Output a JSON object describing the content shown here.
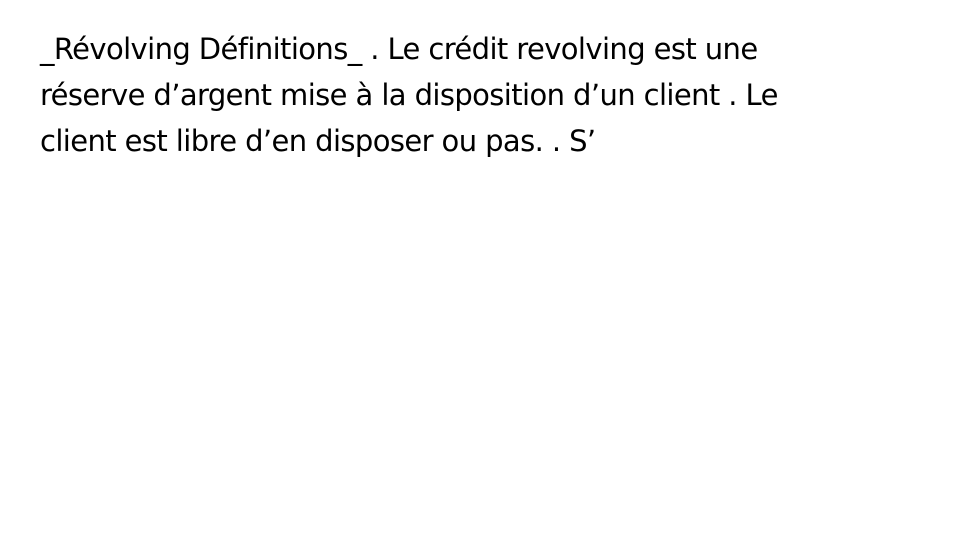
{
  "slide": {
    "lines": [
      "_Révolving Définitions_ . Le crédit revolving est une",
      "réserve d’argent mise à la disposition d’un client . Le",
      "client est libre d’en disposer ou pas. . S’"
    ]
  },
  "colors": {
    "background": "#ffffff",
    "text": "#000000"
  }
}
